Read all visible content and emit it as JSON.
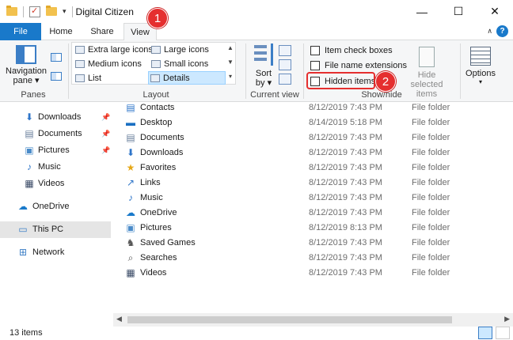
{
  "window": {
    "title": "Digital Citizen"
  },
  "tabs": [
    {
      "label": "File"
    },
    {
      "label": "Home"
    },
    {
      "label": "Share"
    },
    {
      "label": "View"
    }
  ],
  "ribbon": {
    "panes": {
      "navigation_pane_label": "Navigation pane ▾",
      "group_label": "Panes"
    },
    "layout": {
      "options": [
        "Extra large icons",
        "Large icons",
        "Medium icons",
        "Small icons",
        "List",
        "Details"
      ],
      "selected": "Details",
      "group_label": "Layout"
    },
    "current_view": {
      "sort_label": "Sort by ▾",
      "group_label": "Current view"
    },
    "show_hide": {
      "item_check_boxes": "Item check boxes",
      "file_name_extensions": "File name extensions",
      "hidden_items": "Hidden items",
      "hide_selected_items": "Hide selected items",
      "group_label": "Show/hide"
    },
    "options_label": "Options"
  },
  "annotations": [
    "1",
    "2"
  ],
  "nav": {
    "items": [
      {
        "label": "Downloads",
        "icon": "download-arrow-icon",
        "pinned": true
      },
      {
        "label": "Documents",
        "icon": "documents-icon",
        "pinned": true
      },
      {
        "label": "Pictures",
        "icon": "pictures-icon",
        "pinned": true
      },
      {
        "label": "Music",
        "icon": "music-note-icon",
        "pinned": false
      },
      {
        "label": "Videos",
        "icon": "videos-icon",
        "pinned": false
      },
      {
        "label": "OneDrive",
        "icon": "cloud-icon",
        "pinned": false
      },
      {
        "label": "This PC",
        "icon": "computer-icon",
        "pinned": false,
        "selected": true
      },
      {
        "label": "Network",
        "icon": "network-icon",
        "pinned": false
      }
    ]
  },
  "files": [
    {
      "name": "Contacts",
      "date": "8/12/2019 7:43 PM",
      "type": "File folder"
    },
    {
      "name": "Desktop",
      "date": "8/14/2019 5:18 PM",
      "type": "File folder"
    },
    {
      "name": "Documents",
      "date": "8/12/2019 7:43 PM",
      "type": "File folder"
    },
    {
      "name": "Downloads",
      "date": "8/12/2019 7:43 PM",
      "type": "File folder"
    },
    {
      "name": "Favorites",
      "date": "8/12/2019 7:43 PM",
      "type": "File folder"
    },
    {
      "name": "Links",
      "date": "8/12/2019 7:43 PM",
      "type": "File folder"
    },
    {
      "name": "Music",
      "date": "8/12/2019 7:43 PM",
      "type": "File folder"
    },
    {
      "name": "OneDrive",
      "date": "8/12/2019 7:43 PM",
      "type": "File folder"
    },
    {
      "name": "Pictures",
      "date": "8/12/2019 8:13 PM",
      "type": "File folder"
    },
    {
      "name": "Saved Games",
      "date": "8/12/2019 7:43 PM",
      "type": "File folder"
    },
    {
      "name": "Searches",
      "date": "8/12/2019 7:43 PM",
      "type": "File folder"
    },
    {
      "name": "Videos",
      "date": "8/12/2019 7:43 PM",
      "type": "File folder"
    }
  ],
  "status": {
    "item_count": "13 items"
  },
  "colors": {
    "accent": "#1979ca",
    "annotation": "#e52f2f",
    "selection": "#cce8ff"
  }
}
